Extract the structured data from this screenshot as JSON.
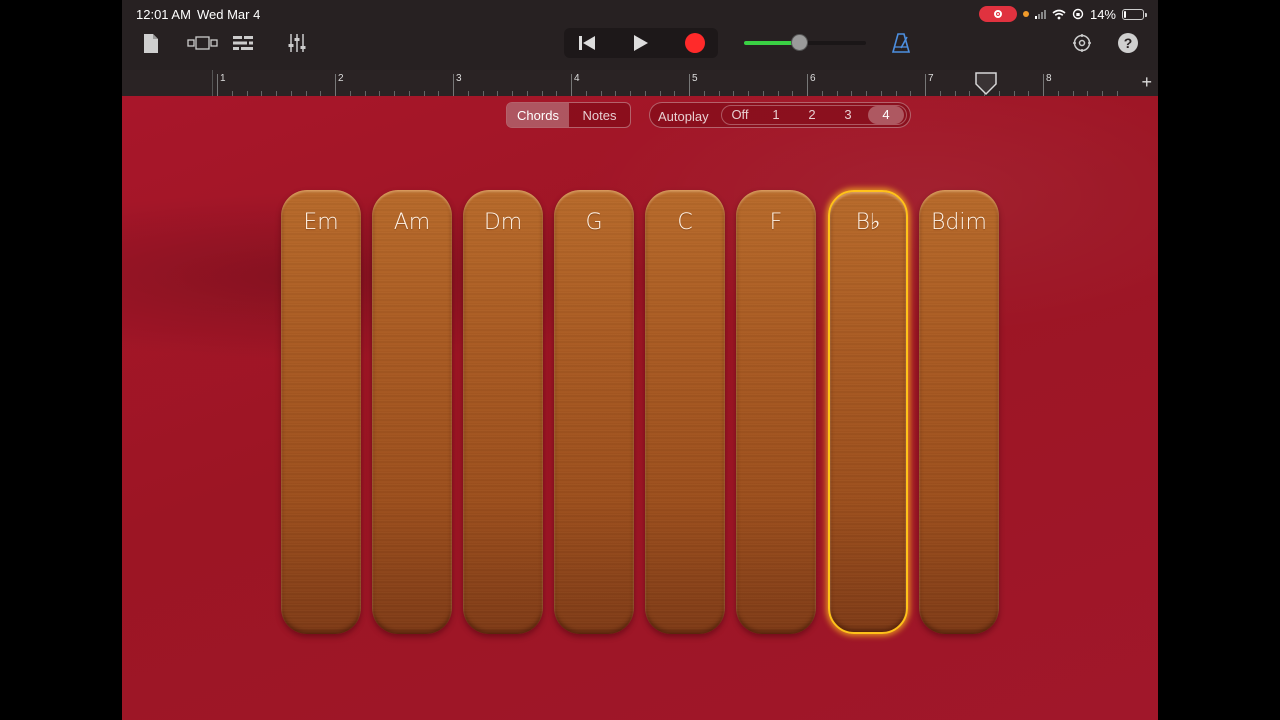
{
  "status_bar": {
    "time": "12:01 AM",
    "date": "Wed Mar 4",
    "battery_percent": "14%",
    "battery_level": 0.14
  },
  "toolbar": {
    "icons": [
      "document-icon",
      "tracks-view-icon",
      "track-list-icon",
      "mixer-icon",
      "rewind-icon",
      "play-icon",
      "record-icon",
      "metronome-icon",
      "settings-icon",
      "help-icon"
    ],
    "help_label": "?",
    "volume_level": 0.45,
    "record_color": "#ff2a2a",
    "volume_color": "#3ad144"
  },
  "ruler": {
    "marks": [
      "1",
      "2",
      "3",
      "4",
      "5",
      "6",
      "7",
      "8"
    ],
    "add_label": "+"
  },
  "mode_toggle": {
    "options": [
      "Chords",
      "Notes"
    ],
    "selected": "Chords"
  },
  "autoplay": {
    "label": "Autoplay",
    "options": [
      "Off",
      "1",
      "2",
      "3",
      "4"
    ],
    "selected": "4"
  },
  "chords": [
    "Em",
    "Am",
    "Dm",
    "G",
    "C",
    "F",
    "B♭",
    "Bdim"
  ],
  "selected_chord": "B♭",
  "colors": {
    "background_fabric": "#a01522",
    "strip_wood": "#a95a22",
    "selected_outline": "#ffc21a"
  }
}
